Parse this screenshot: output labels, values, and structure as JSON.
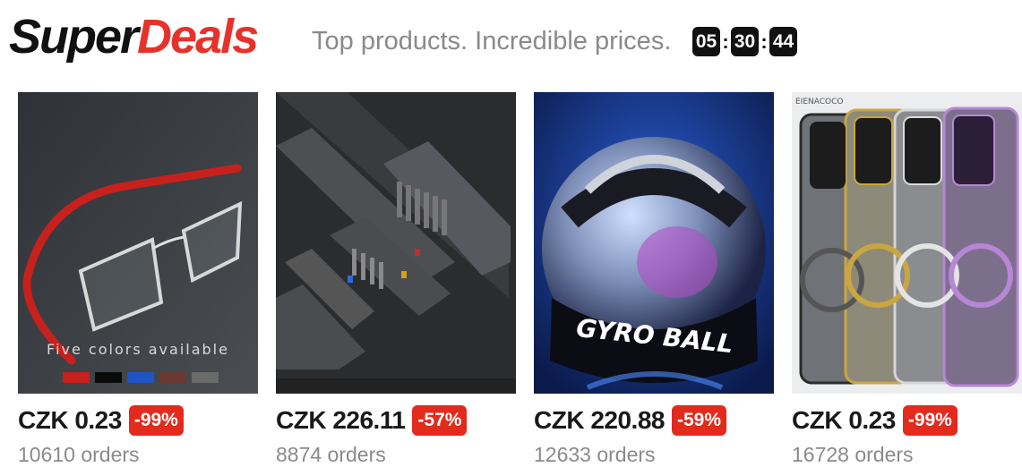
{
  "header": {
    "logo_part1": "Super",
    "logo_part2": "Deals",
    "tagline": "Top products. Incredible prices.",
    "timer": {
      "hours": "05",
      "minutes": "30",
      "seconds": "44",
      "separator": ":"
    }
  },
  "products": [
    {
      "image_text": "Five colors available",
      "price": "CZK 0.23",
      "discount": "-99%",
      "orders": "10610 orders"
    },
    {
      "price": "CZK 226.11",
      "discount": "-57%",
      "orders": "8874 orders"
    },
    {
      "image_text": "GYRO BALL",
      "price": "CZK 220.88",
      "discount": "-59%",
      "orders": "12633 orders"
    },
    {
      "image_text": "EIENACOCO",
      "price": "CZK 0.23",
      "discount": "-99%",
      "orders": "16728 orders"
    }
  ],
  "colors": {
    "accent": "#e6322b",
    "badge": "#e22a1d",
    "muted_text": "#8a8a8a",
    "dark": "#111111"
  }
}
